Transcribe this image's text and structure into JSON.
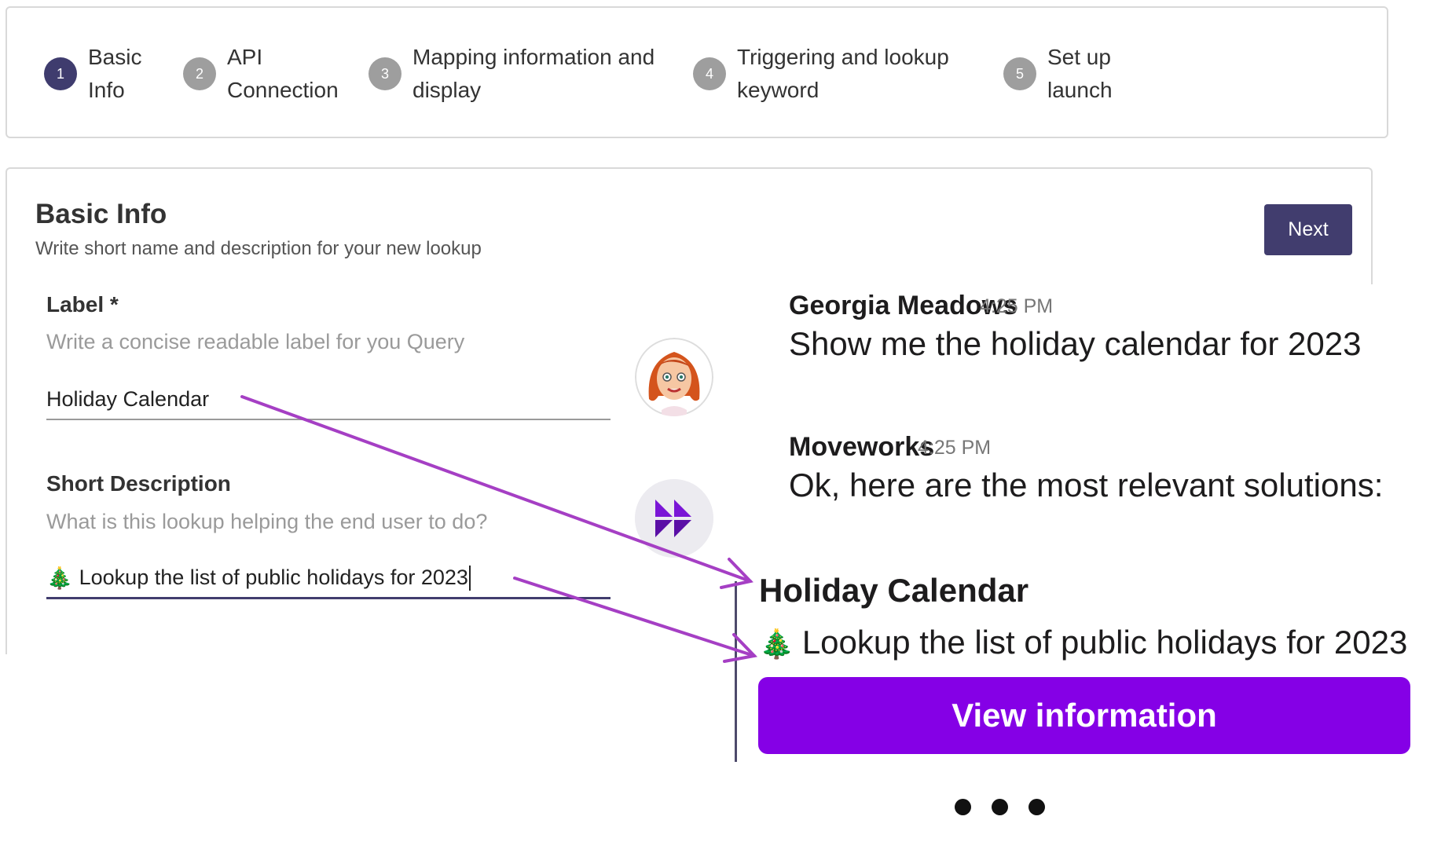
{
  "stepper": {
    "steps": [
      {
        "number": "1",
        "label_line1": "Basic",
        "label_line2": "Info",
        "active": true
      },
      {
        "number": "2",
        "label_line1": "API",
        "label_line2": "Connection",
        "active": false
      },
      {
        "number": "3",
        "label_line1": "Mapping information and",
        "label_line2": "display",
        "active": false
      },
      {
        "number": "4",
        "label_line1": "Triggering and lookup",
        "label_line2": "keyword",
        "active": false
      },
      {
        "number": "5",
        "label_line1": "Set up",
        "label_line2": "launch",
        "active": false
      }
    ]
  },
  "basic_info": {
    "title": "Basic Info",
    "subtitle": "Write short name and description for your new lookup",
    "next_label": "Next",
    "label_field": {
      "label": "Label *",
      "hint": "Write a concise readable label for you Query",
      "value": "Holiday Calendar"
    },
    "description_field": {
      "label": "Short Description",
      "hint": "What is this lookup helping the end user to do?",
      "emoji": "🎄",
      "value": "Lookup the list of public holidays for 2023"
    }
  },
  "chat": {
    "messages": [
      {
        "sender": "Georgia Meadows",
        "time": "4:25 PM",
        "text": "Show me the holiday calendar for 2023",
        "avatar_icon": "user-avatar-icon"
      },
      {
        "sender": "Moveworks",
        "time": "4:25 PM",
        "text": "Ok, here are the most relevant solutions:",
        "avatar_icon": "moveworks-logo-icon"
      }
    ],
    "card": {
      "title": "Holiday Calendar",
      "emoji": "🎄",
      "description": "Lookup the list of public holidays for 2023",
      "button_label": "View information"
    },
    "typing_indicator": "typing-dots-icon"
  },
  "colors": {
    "active_step": "#3f3c6e",
    "inactive_step": "#9e9e9e",
    "next_button": "#413d6e",
    "view_button": "#8500e6",
    "arrow": "#a53fc4"
  }
}
